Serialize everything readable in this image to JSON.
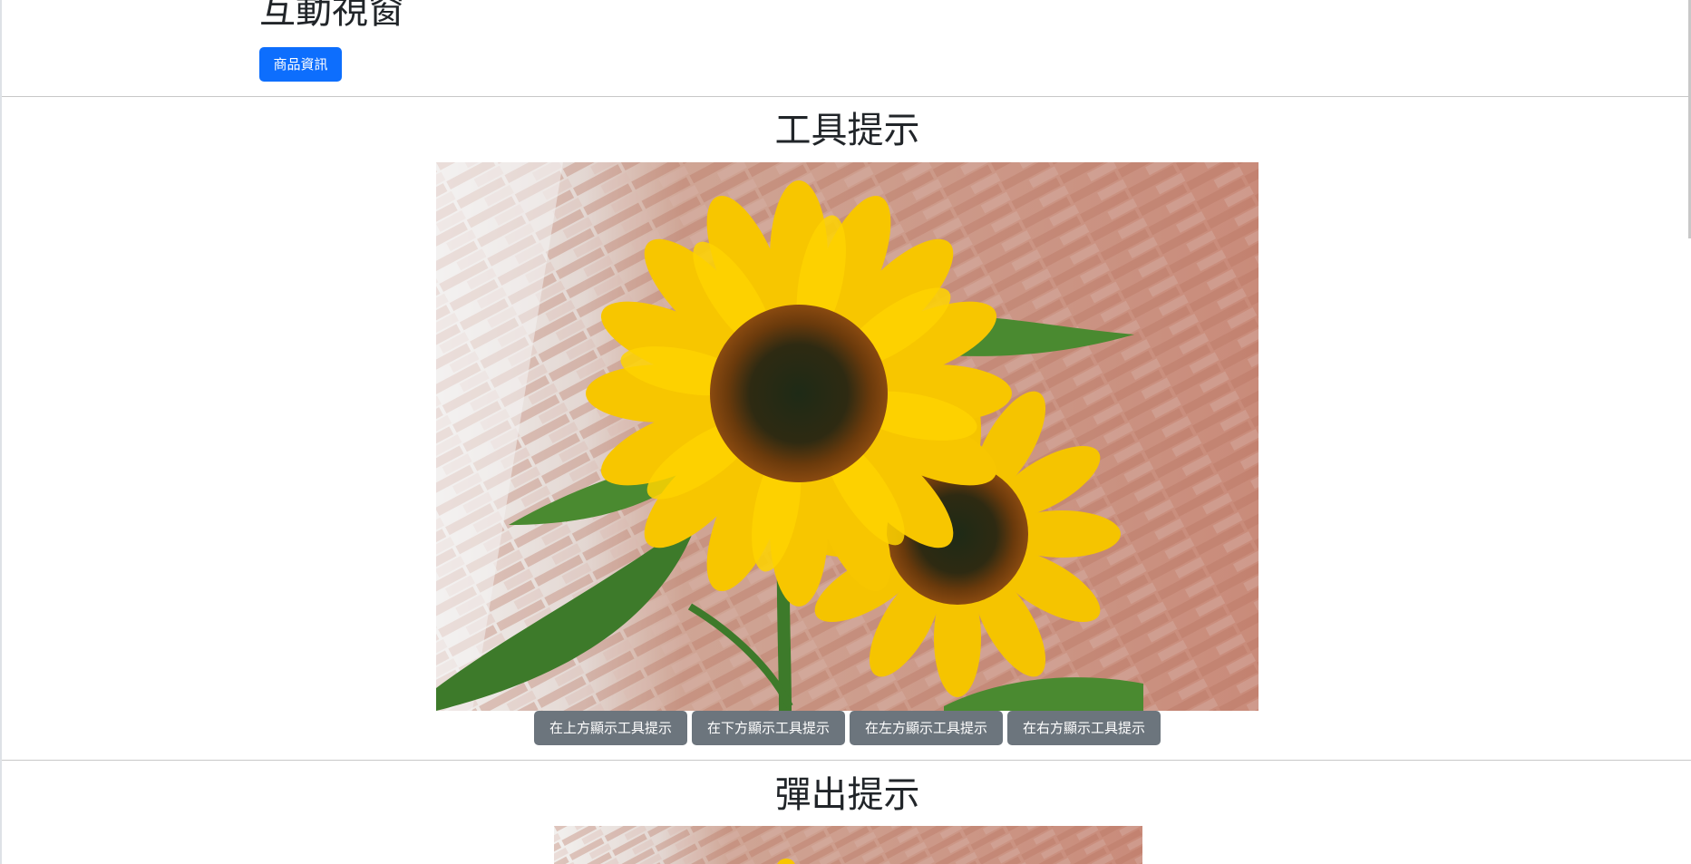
{
  "header": {
    "title": "互動視窗",
    "product_button_label": "商品資訊"
  },
  "tooltip_section": {
    "heading": "工具提示",
    "image_alt": "sunflower-photo",
    "buttons": [
      {
        "label": "在上方顯示工具提示"
      },
      {
        "label": "在下方顯示工具提示"
      },
      {
        "label": "在左方顯示工具提示"
      },
      {
        "label": "在右方顯示工具提示"
      }
    ]
  },
  "popover_section": {
    "heading": "彈出提示",
    "image_alt": "sunflower-photo"
  },
  "colors": {
    "primary": "#0d6efd",
    "secondary": "#6c757d",
    "petal_yellow": "#f5c400",
    "leaf_green": "#3d7a2a",
    "brick": "#c98b7a"
  }
}
